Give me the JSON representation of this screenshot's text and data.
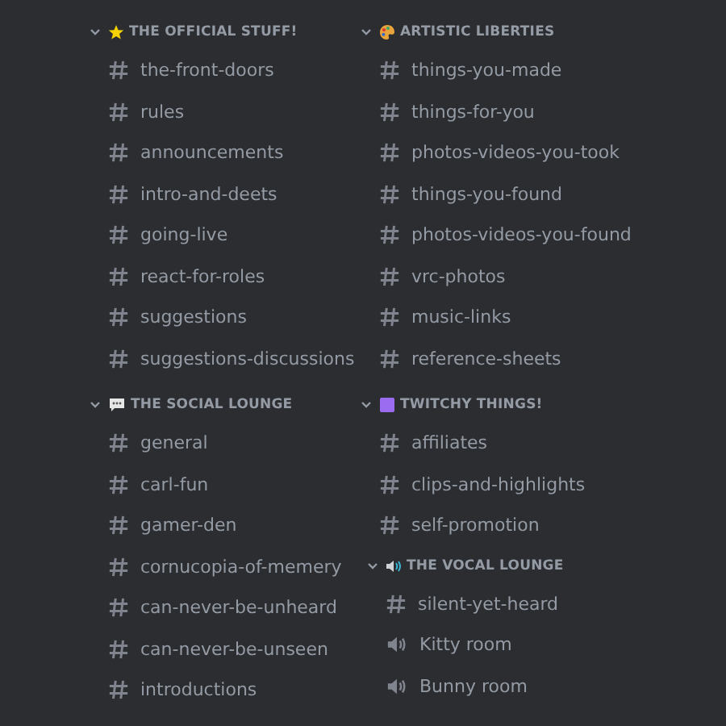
{
  "columns": [
    {
      "categories": [
        {
          "name": "THE OFFICIAL STUFF!",
          "kind": "star",
          "expanded": true,
          "channels": [
            {
              "name": "the-front-doors",
              "kind": "text"
            },
            {
              "name": "rules",
              "kind": "text"
            },
            {
              "name": "announcements",
              "kind": "text"
            },
            {
              "name": "intro-and-deets",
              "kind": "text"
            },
            {
              "name": "going-live",
              "kind": "text"
            },
            {
              "name": "react-for-roles",
              "kind": "text"
            },
            {
              "name": "suggestions",
              "kind": "text"
            },
            {
              "name": "suggestions-discussions",
              "kind": "text"
            }
          ]
        },
        {
          "name": "THE SOCIAL LOUNGE",
          "kind": "chat",
          "expanded": true,
          "channels": [
            {
              "name": "general",
              "kind": "text"
            },
            {
              "name": "carl-fun",
              "kind": "text"
            },
            {
              "name": "gamer-den",
              "kind": "text"
            },
            {
              "name": "cornucopia-of-memery",
              "kind": "text"
            },
            {
              "name": "can-never-be-unheard",
              "kind": "text"
            },
            {
              "name": "can-never-be-unseen",
              "kind": "text"
            },
            {
              "name": "introductions",
              "kind": "text"
            }
          ]
        }
      ]
    },
    {
      "categories": [
        {
          "name": "ARTISTIC LIBERTIES",
          "kind": "palette",
          "expanded": true,
          "channels": [
            {
              "name": "things-you-made",
              "kind": "text"
            },
            {
              "name": "things-for-you",
              "kind": "text"
            },
            {
              "name": "photos-videos-you-took",
              "kind": "text"
            },
            {
              "name": "things-you-found",
              "kind": "text"
            },
            {
              "name": "photos-videos-you-found",
              "kind": "text"
            },
            {
              "name": "vrc-photos",
              "kind": "text"
            },
            {
              "name": "music-links",
              "kind": "text"
            },
            {
              "name": "reference-sheets",
              "kind": "text"
            }
          ]
        },
        {
          "name": "TWITCHY THINGS!",
          "kind": "square",
          "expanded": true,
          "channels": [
            {
              "name": "affiliates",
              "kind": "text"
            },
            {
              "name": "clips-and-highlights",
              "kind": "text"
            },
            {
              "name": "self-promotion",
              "kind": "text"
            }
          ]
        },
        {
          "name": "THE VOCAL LOUNGE",
          "kind": "speaker",
          "expanded": true,
          "channels": [
            {
              "name": "silent-yet-heard",
              "kind": "text"
            },
            {
              "name": "Kitty room",
              "kind": "voice"
            },
            {
              "name": "Bunny room",
              "kind": "voice"
            }
          ]
        }
      ]
    }
  ]
}
